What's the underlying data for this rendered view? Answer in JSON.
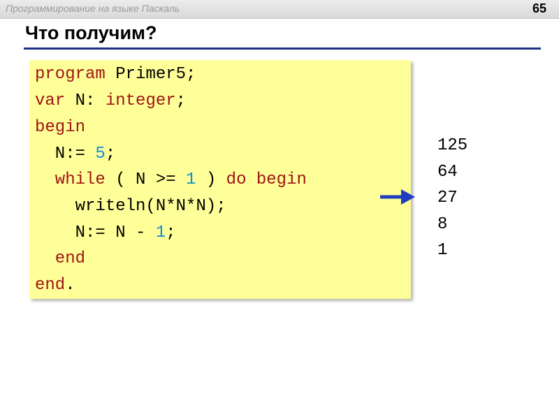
{
  "header": {
    "title": "Программирование на языке Паскаль",
    "page_number": "65"
  },
  "slide": {
    "title": "Что получим?"
  },
  "code": {
    "line1": {
      "a": "program",
      "b": " Primer5;"
    },
    "line2": {
      "a": "var",
      "b": " N: ",
      "c": "integer",
      "d": ";"
    },
    "line3": {
      "a": "begin"
    },
    "line4": {
      "a": "  N:= ",
      "b": "5",
      "c": ";"
    },
    "line5": {
      "a": "  while",
      "b": " ( N >= ",
      "c": "1",
      "d": " ) ",
      "e": "do begin"
    },
    "line6": {
      "a": "    writeln(N*N*N);"
    },
    "line7": {
      "a": "    N:= N - ",
      "b": "1",
      "c": ";"
    },
    "line8": {
      "a": "  end"
    },
    "line9": {
      "a": "end",
      "b": "."
    }
  },
  "output": [
    "125",
    "64",
    "27",
    "8",
    "1"
  ],
  "colors": {
    "keyword": "#a01414",
    "number": "#0b8fd6",
    "code_background": "#ffff99",
    "arrow": "#1f3fbf",
    "title_rule": "#1a2f86"
  },
  "icons": {
    "arrow": "arrow-right-icon"
  }
}
